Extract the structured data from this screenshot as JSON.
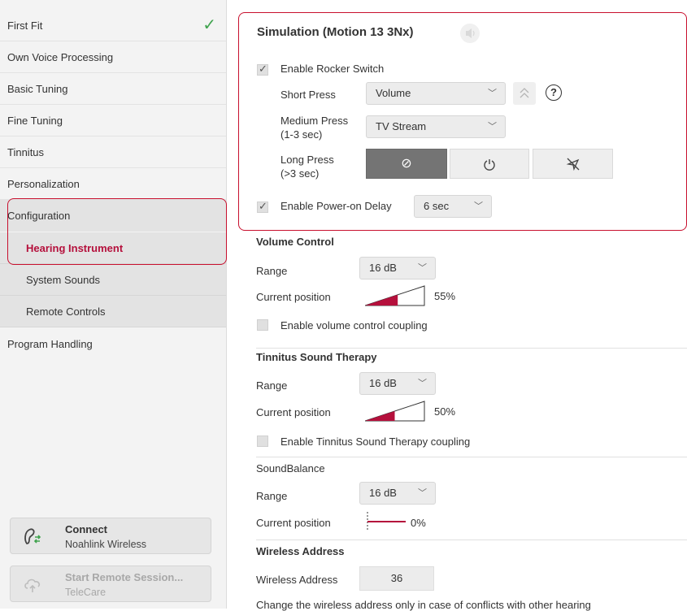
{
  "sidebar": {
    "items": [
      {
        "label": "First Fit",
        "done": true
      },
      {
        "label": "Own Voice Processing"
      },
      {
        "label": "Basic Tuning"
      },
      {
        "label": "Fine Tuning"
      },
      {
        "label": "Tinnitus"
      },
      {
        "label": "Personalization"
      },
      {
        "label": "Configuration"
      },
      {
        "label": "Hearing Instrument"
      },
      {
        "label": "System Sounds"
      },
      {
        "label": "Remote Controls"
      },
      {
        "label": "Program Handling"
      }
    ],
    "connect": {
      "title": "Connect",
      "subtitle": "Noahlink Wireless"
    },
    "remote": {
      "title": "Start Remote Session...",
      "subtitle": "TeleCare"
    }
  },
  "simulation": {
    "title": "Simulation (Motion 13 3Nx)",
    "rocker_label": "Enable Rocker Switch",
    "rocker_checked": true,
    "short_press_label": "Short Press",
    "short_press_value": "Volume",
    "help_glyph": "?",
    "medium_press_label1": "Medium Press",
    "medium_press_label2": "(1-3 sec)",
    "medium_press_value": "TV Stream",
    "long_press_label1": "Long Press",
    "long_press_label2": "(>3 sec)",
    "power_delay_label": "Enable Power-on Delay",
    "power_delay_checked": true,
    "power_delay_value": "6 sec"
  },
  "volume": {
    "title": "Volume Control",
    "range_label": "Range",
    "range_value": "16 dB",
    "position_label": "Current position",
    "position_pct": "55%",
    "position_fraction": 0.55,
    "coupling_label": "Enable volume control coupling"
  },
  "tinnitus": {
    "title": "Tinnitus Sound Therapy",
    "range_label": "Range",
    "range_value": "16 dB",
    "position_label": "Current position",
    "position_pct": "50%",
    "position_fraction": 0.5,
    "coupling_label": "Enable Tinnitus Sound Therapy coupling"
  },
  "soundbalance": {
    "title": "SoundBalance",
    "range_label": "Range",
    "range_value": "16 dB",
    "position_label": "Current position",
    "position_pct": "0%"
  },
  "wireless": {
    "title": "Wireless Address",
    "address_label": "Wireless Address",
    "address_value": "36",
    "note": "Change the wireless address only in case of conflicts with other hearing"
  },
  "colors": {
    "accent": "#b5103c",
    "check": "#3fa34d",
    "outline": "#c8102e"
  }
}
